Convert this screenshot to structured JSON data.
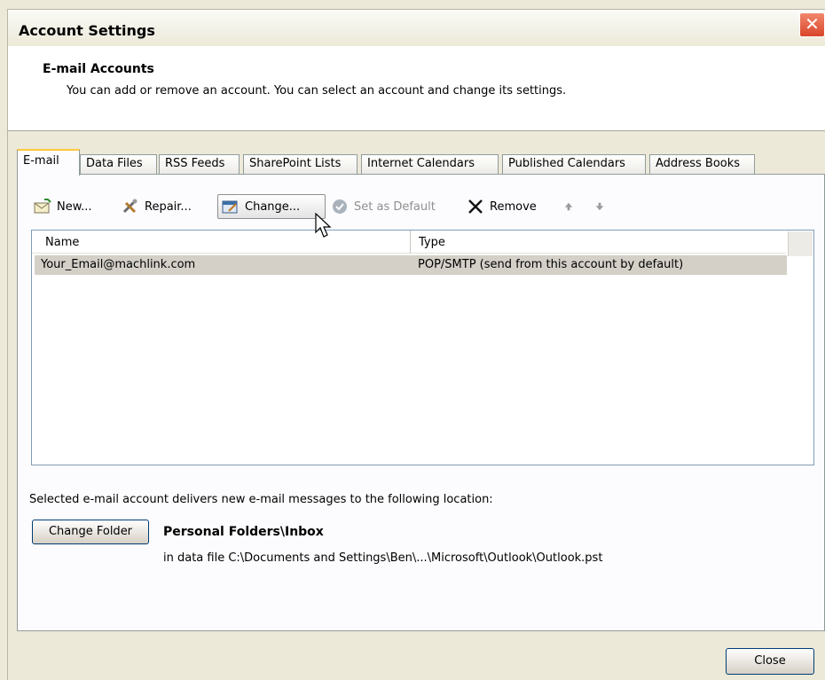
{
  "window": {
    "title": "Account Settings",
    "close_glyph": "✕"
  },
  "header": {
    "title": "E-mail Accounts",
    "description": "You can add or remove an account. You can select an account and change its settings."
  },
  "tabs": [
    {
      "label": "E-mail",
      "active": true
    },
    {
      "label": "Data Files"
    },
    {
      "label": "RSS Feeds"
    },
    {
      "label": "SharePoint Lists"
    },
    {
      "label": "Internet Calendars"
    },
    {
      "label": "Published Calendars"
    },
    {
      "label": "Address Books"
    }
  ],
  "toolbar": {
    "new_label": "New...",
    "repair_label": "Repair...",
    "change_label": "Change...",
    "set_default_label": "Set as Default",
    "remove_label": "Remove"
  },
  "account_list": {
    "columns": [
      "Name",
      "Type"
    ],
    "rows": [
      {
        "name": "Your_Email@machlink.com",
        "type": "POP/SMTP (send from this account by default)",
        "selected": true
      }
    ]
  },
  "delivery": {
    "info_text": "Selected e-mail account delivers new e-mail messages to the following location:",
    "change_folder_label": "Change Folder",
    "folder_title": "Personal Folders\\Inbox",
    "folder_path": "in data file C:\\Documents and Settings\\Ben\\...\\Microsoft\\Outlook\\Outlook.pst"
  },
  "footer": {
    "close_label": "Close"
  },
  "colors": {
    "selection": "#d4d0c8",
    "active_tab_accent": "#ffc83c",
    "dialog_bg": "#ece9d8"
  }
}
